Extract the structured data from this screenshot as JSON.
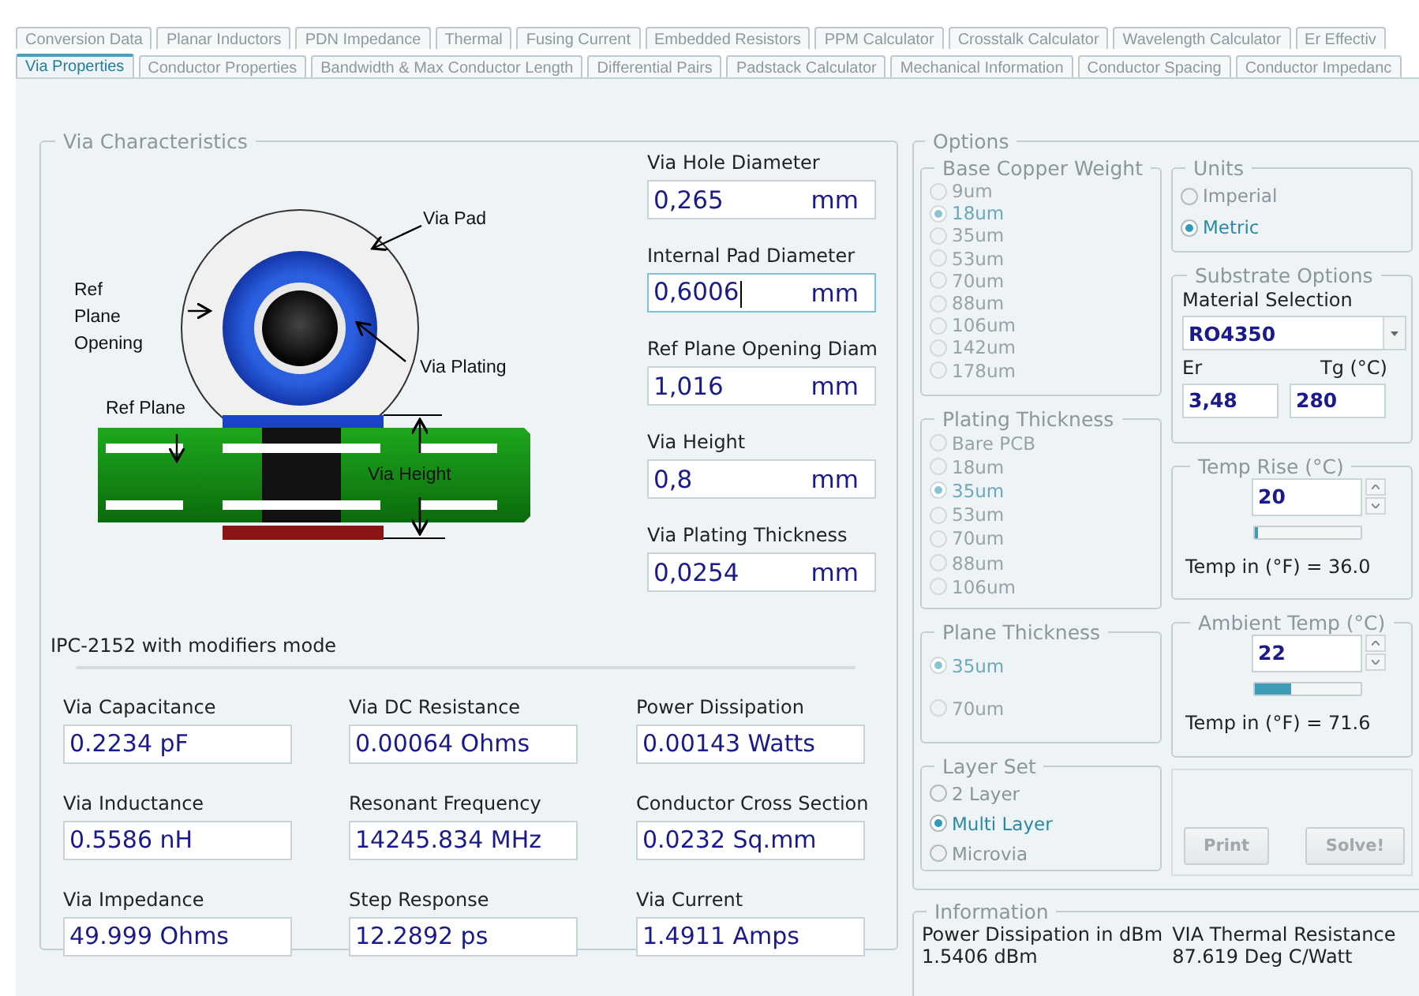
{
  "tabs_back": [
    {
      "label": "Conversion Data",
      "selected": false
    },
    {
      "label": "Planar Inductors",
      "selected": false
    },
    {
      "label": "PDN  Impedance",
      "selected": false
    },
    {
      "label": "Thermal",
      "selected": false
    },
    {
      "label": "Fusing Current",
      "selected": false
    },
    {
      "label": "Embedded Resistors",
      "selected": false
    },
    {
      "label": "PPM Calculator",
      "selected": false
    },
    {
      "label": "Crosstalk Calculator",
      "selected": false
    },
    {
      "label": "Wavelength Calculator",
      "selected": false
    },
    {
      "label": "Er Effectiv",
      "selected": false
    }
  ],
  "tabs_front": [
    {
      "label": "Via Properties",
      "selected": true
    },
    {
      "label": "Conductor Properties",
      "selected": false
    },
    {
      "label": "Bandwidth & Max Conductor Length",
      "selected": false
    },
    {
      "label": "Differential Pairs",
      "selected": false
    },
    {
      "label": "Padstack Calculator",
      "selected": false
    },
    {
      "label": "Mechanical Information",
      "selected": false
    },
    {
      "label": "Conductor Spacing",
      "selected": false
    },
    {
      "label": "Conductor Impedanc",
      "selected": false
    }
  ],
  "via_characteristics": {
    "title": "Via Characteristics",
    "diagram_labels": {
      "via_pad": "Via Pad",
      "ref_plane_opening": "Ref Plane Opening",
      "via_plating": "Via Plating",
      "ref_plane": "Ref Plane",
      "via_height": "Via Height"
    },
    "inputs": [
      {
        "label": "Via Hole Diameter",
        "value": "0,265",
        "unit": "mm",
        "focused": false
      },
      {
        "label": "Internal Pad Diameter",
        "value": "0,6006",
        "unit": "mm",
        "focused": true
      },
      {
        "label": "Ref Plane Opening Diam",
        "value": "1,016",
        "unit": "mm",
        "focused": false
      },
      {
        "label": "Via Height",
        "value": "0,8",
        "unit": "mm",
        "focused": false
      },
      {
        "label": "Via Plating Thickness",
        "value": "0,0254",
        "unit": "mm",
        "focused": false
      }
    ],
    "mode_text": "IPC-2152 with modifiers mode",
    "progress": {
      "level": 0
    },
    "results": [
      {
        "label": "Via Capacitance",
        "value": "0.2234 pF"
      },
      {
        "label": "Via DC Resistance",
        "value": "0.00064 Ohms"
      },
      {
        "label": "Power Dissipation",
        "value": "0.00143 Watts"
      },
      {
        "label": "Via Inductance",
        "value": "0.5586 nH"
      },
      {
        "label": "Resonant Frequency",
        "value": "14245.834 MHz"
      },
      {
        "label": "Conductor Cross Section",
        "value": "0.0232 Sq.mm"
      },
      {
        "label": "Via Impedance",
        "value": "49.999 Ohms"
      },
      {
        "label": "Step Response",
        "value": "12.2892 ps"
      },
      {
        "label": "Via Current",
        "value": "1.4911 Amps"
      }
    ]
  },
  "options": {
    "title": "Options",
    "base_copper_weight": {
      "title": "Base Copper Weight",
      "disabled": true,
      "options": [
        {
          "label": "9um",
          "selected": false
        },
        {
          "label": "18um",
          "selected": true
        },
        {
          "label": "35um",
          "selected": false
        },
        {
          "label": "53um",
          "selected": false
        },
        {
          "label": "70um",
          "selected": false
        },
        {
          "label": "88um",
          "selected": false
        },
        {
          "label": "106um",
          "selected": false
        },
        {
          "label": "142um",
          "selected": false
        },
        {
          "label": "178um",
          "selected": false
        }
      ]
    },
    "plating_thickness": {
      "title": "Plating Thickness",
      "disabled": true,
      "options": [
        {
          "label": "Bare PCB",
          "selected": false
        },
        {
          "label": "18um",
          "selected": false
        },
        {
          "label": "35um",
          "selected": true
        },
        {
          "label": "53um",
          "selected": false
        },
        {
          "label": "70um",
          "selected": false
        },
        {
          "label": "88um",
          "selected": false
        },
        {
          "label": "106um",
          "selected": false
        }
      ]
    },
    "plane_thickness": {
      "title": "Plane Thickness",
      "disabled": true,
      "options": [
        {
          "label": "35um",
          "selected": true
        },
        {
          "label": "70um",
          "selected": false
        }
      ]
    },
    "layer_set": {
      "title": "Layer Set",
      "disabled": false,
      "options": [
        {
          "label": "2 Layer",
          "selected": false
        },
        {
          "label": "Multi Layer",
          "selected": true
        },
        {
          "label": "Microvia",
          "selected": false
        }
      ]
    },
    "units": {
      "title": "Units",
      "disabled": false,
      "options": [
        {
          "label": "Imperial",
          "selected": false
        },
        {
          "label": "Metric",
          "selected": true
        }
      ]
    },
    "substrate": {
      "title": "Substrate Options",
      "material_label": "Material Selection",
      "material": "RO4350",
      "er_label": "Er",
      "er": "3,48",
      "tg_label": "Tg (°C)",
      "tg": "280"
    },
    "temp_rise": {
      "title": "Temp Rise (°C)",
      "value": "20",
      "level": 0.02,
      "reading": "Temp in (°F) = 36.0"
    },
    "ambient_temp": {
      "title": "Ambient Temp (°C)",
      "value": "22",
      "level": 0.35,
      "reading": "Temp in (°F) = 71.6"
    },
    "buttons": [
      {
        "label": "Print",
        "disabled": true
      },
      {
        "label": "Solve!",
        "disabled": true
      }
    ]
  },
  "information": {
    "title": "Information",
    "items": [
      {
        "label": "Power Dissipation in dBm",
        "value": "1.5406 dBm"
      },
      {
        "label": "VIA Thermal Resistance",
        "value": "87.619 Deg C/Watt"
      }
    ]
  }
}
